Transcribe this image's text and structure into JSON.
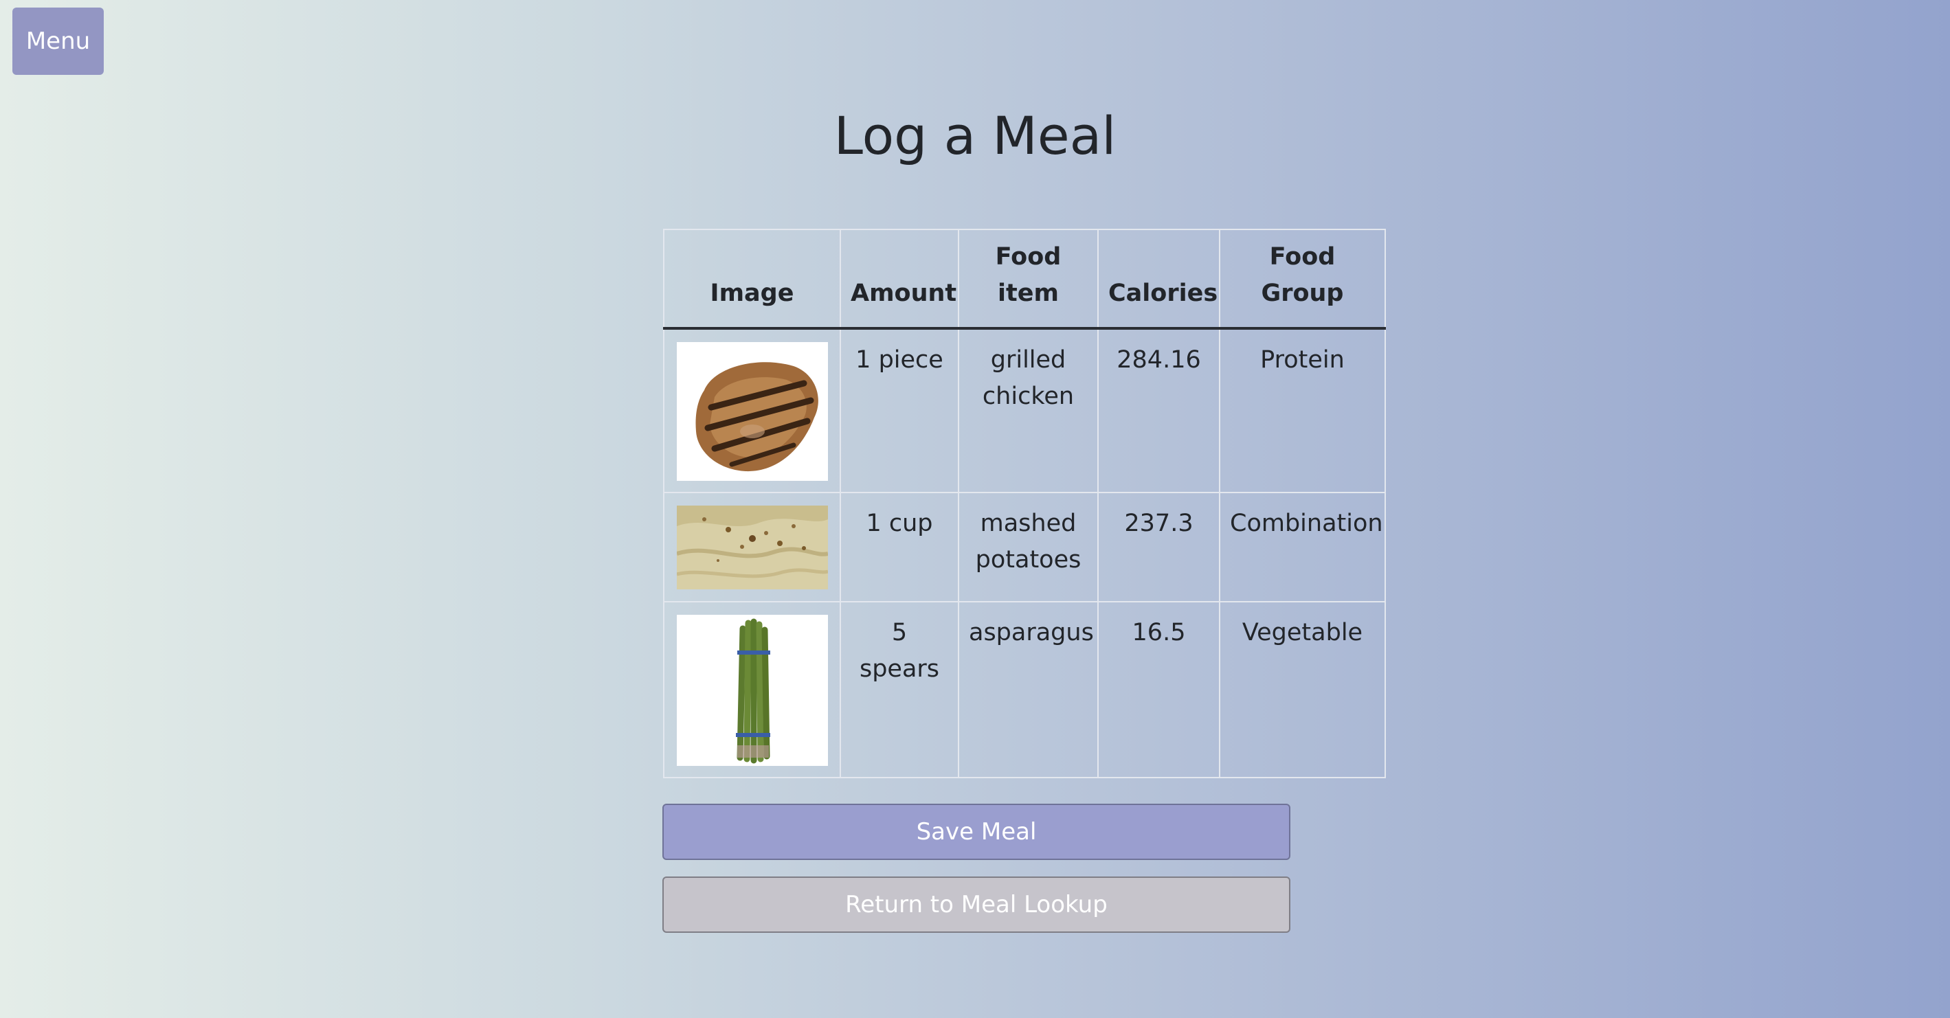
{
  "nav": {
    "menu_label": "Menu"
  },
  "page": {
    "title": "Log a Meal"
  },
  "table": {
    "headers": {
      "image": "Image",
      "amount": "Amount",
      "food_item": "Food item",
      "calories": "Calories",
      "food_group": "Food Group"
    },
    "rows": [
      {
        "image_icon": "grilled-chicken-image",
        "amount": "1 piece",
        "food_item": "grilled chicken",
        "calories": "284.16",
        "food_group": "Protein"
      },
      {
        "image_icon": "mashed-potatoes-image",
        "amount": "1 cup",
        "food_item": "mashed potatoes",
        "calories": "237.3",
        "food_group": "Combination"
      },
      {
        "image_icon": "asparagus-image",
        "amount": "5 spears",
        "food_item": "asparagus",
        "calories": "16.5",
        "food_group": "Vegetable"
      }
    ]
  },
  "actions": {
    "save_label": "Save Meal",
    "return_label": "Return to Meal Lookup"
  },
  "colors": {
    "menu_button": "#9396c3",
    "save_button": "#9a9ecf",
    "return_button": "#c6c4cb",
    "background_start": "#e4ede8",
    "background_end": "#93a3cd"
  }
}
